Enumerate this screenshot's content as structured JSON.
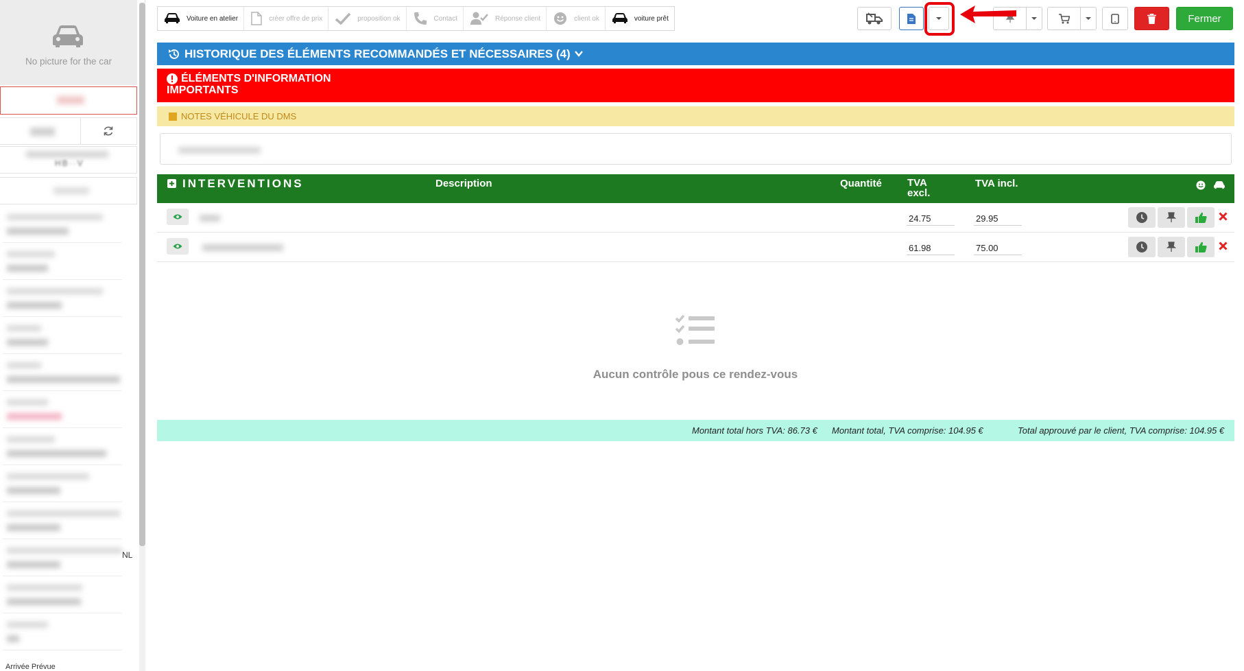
{
  "sidebar": {
    "no_picture": "No picture for the car",
    "vin_partial": "NL",
    "arrivee_label": "Arrivée Prévue"
  },
  "workflow_steps": [
    {
      "label": "Voiture en atelier",
      "icon": "car-icon",
      "active": true
    },
    {
      "label": "créer offre de prix",
      "icon": "document-icon",
      "active": false
    },
    {
      "label": "proposition ok",
      "icon": "check-icon",
      "active": false
    },
    {
      "label": "Contact",
      "icon": "phone-icon",
      "active": false
    },
    {
      "label": "Réponse client",
      "icon": "user-check-icon",
      "active": false
    },
    {
      "label": "client ok",
      "icon": "smile-icon",
      "active": false
    },
    {
      "label": "voiture prêt",
      "icon": "car-icon",
      "active": true
    }
  ],
  "toolbar": {
    "close_label": "Fermer"
  },
  "banners": {
    "history": "HISTORIQUE DES ÉLÉMENTS RECOMMANDÉS ET NÉCESSAIRES (4)",
    "important_line1": "ÉLÉMENTS D'INFORMATION",
    "important_line2": "IMPORTANTS",
    "dms_notes": "NOTES VÉHICULE DU DMS"
  },
  "table": {
    "headers": {
      "interventions": "INTERVENTIONS",
      "description": "Description",
      "quantity": "Quantité",
      "tva_excl_line1": "TVA",
      "tva_excl_line2": "excl.",
      "tva_incl": "TVA incl."
    },
    "rows": [
      {
        "tva_excl": "24.75",
        "tva_incl": "29.95"
      },
      {
        "tva_excl": "61.98",
        "tva_incl": "75.00"
      }
    ]
  },
  "empty_state": {
    "message": "Aucun contrôle pous ce rendez-vous"
  },
  "totals": {
    "total_excl": "Montant total hors TVA: 86.73 €",
    "total_incl": "Montant total, TVA comprise: 104.95 €",
    "total_approved": "Total approuvé par le client, TVA comprise: 104.95 €"
  },
  "colors": {
    "history_banner": "#2a86cf",
    "important_banner": "#fe0000",
    "notes_banner": "#f7e8a4",
    "table_header": "#1e7a20",
    "totals_bar": "#b4f7e4",
    "close_button": "#2eaa3a",
    "delete_button": "#e02424",
    "annotation": "#e8000b"
  }
}
